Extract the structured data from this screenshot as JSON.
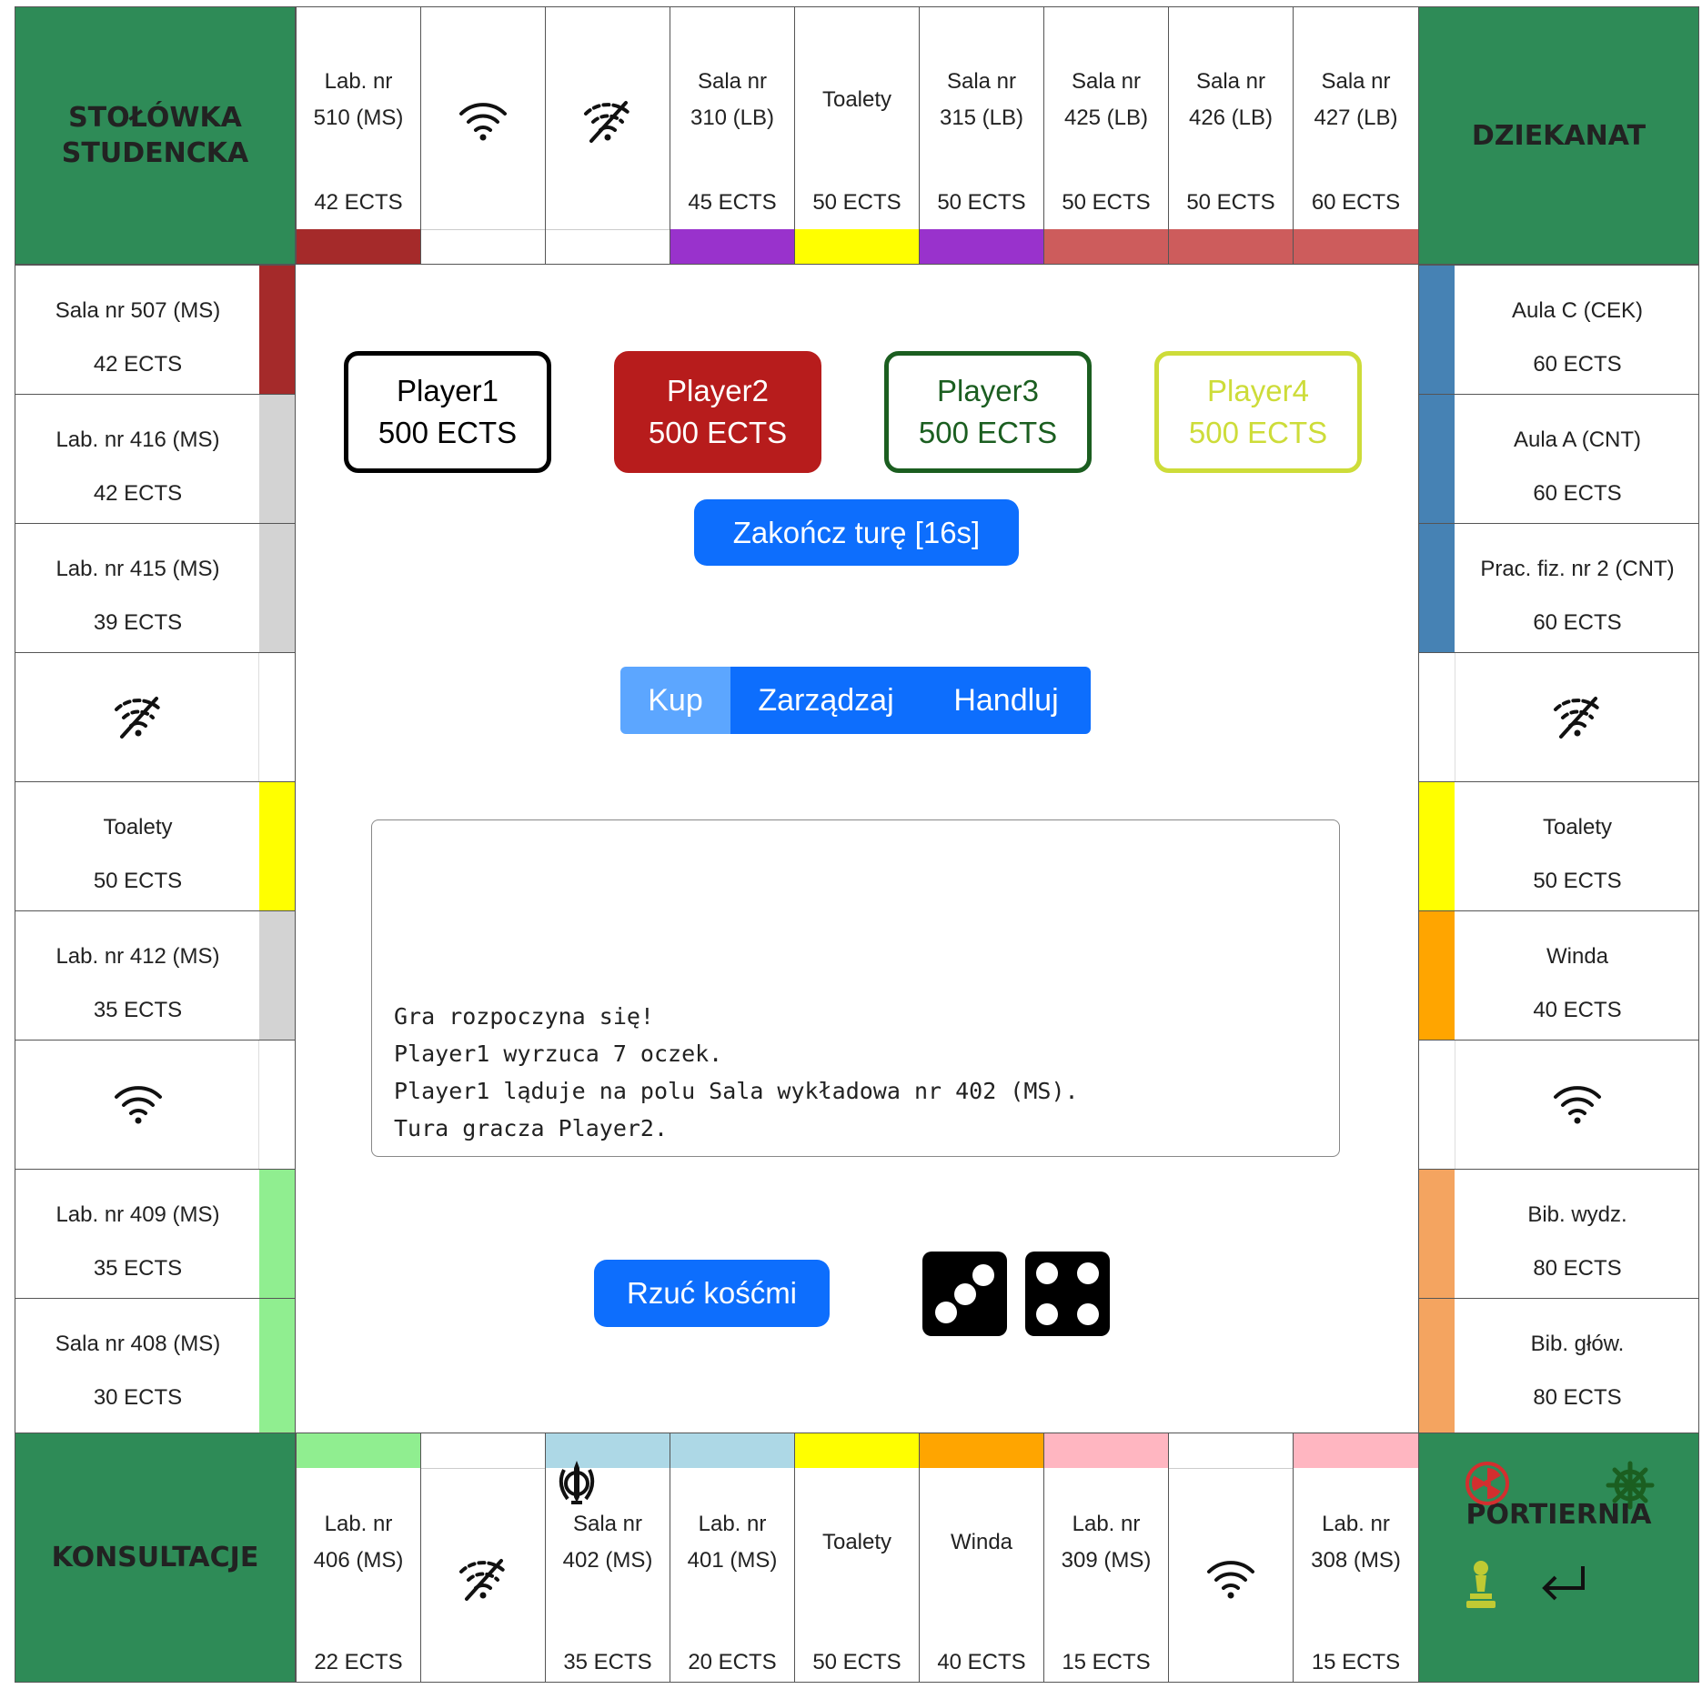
{
  "corners": {
    "top_left": {
      "line1": "STOŁÓWKA",
      "line2": "STUDENCKA"
    },
    "top_right": {
      "label": "DZIEKANAT"
    },
    "bottom_left": {
      "label": "KONSULTACJE"
    },
    "bottom_right": {
      "label": "PORTIERNIA"
    }
  },
  "top_row": [
    {
      "line1": "Lab. nr",
      "line2": "510 (MS)",
      "price": "42 ECTS",
      "color": "#a52a2a"
    },
    {
      "icon": "wifi-icon"
    },
    {
      "icon": "wifi-off-icon"
    },
    {
      "line1": "Sala nr",
      "line2": "310 (LB)",
      "price": "45 ECTS",
      "color": "#9932cc"
    },
    {
      "line1": "Toalety",
      "price": "50 ECTS",
      "color": "#ffff00"
    },
    {
      "line1": "Sala nr",
      "line2": "315 (LB)",
      "price": "50 ECTS",
      "color": "#9932cc"
    },
    {
      "line1": "Sala nr",
      "line2": "425 (LB)",
      "price": "50 ECTS",
      "color": "#cd5c5c"
    },
    {
      "line1": "Sala nr",
      "line2": "426 (LB)",
      "price": "50 ECTS",
      "color": "#cd5c5c"
    },
    {
      "line1": "Sala nr",
      "line2": "427 (LB)",
      "price": "60 ECTS",
      "color": "#cd5c5c"
    }
  ],
  "left_col": [
    {
      "name": "Sala nr 507 (MS)",
      "price": "42 ECTS",
      "color": "#a52a2a"
    },
    {
      "name": "Lab. nr 416 (MS)",
      "price": "42 ECTS",
      "color": "#d3d3d3"
    },
    {
      "name": "Lab. nr 415 (MS)",
      "price": "39 ECTS",
      "color": "#d3d3d3"
    },
    {
      "icon": "wifi-off-icon"
    },
    {
      "name": "Toalety",
      "price": "50 ECTS",
      "color": "#ffff00"
    },
    {
      "name": "Lab. nr 412 (MS)",
      "price": "35 ECTS",
      "color": "#d3d3d3"
    },
    {
      "icon": "wifi-icon"
    },
    {
      "name": "Lab. nr 409 (MS)",
      "price": "35 ECTS",
      "color": "#90ee90"
    },
    {
      "name": "Sala nr 408 (MS)",
      "price": "30 ECTS",
      "color": "#90ee90"
    }
  ],
  "right_col": [
    {
      "name": "Aula C (CEK)",
      "price": "60 ECTS",
      "color": "#4682b4"
    },
    {
      "name": "Aula A (CNT)",
      "price": "60 ECTS",
      "color": "#4682b4"
    },
    {
      "name": "Prac. fiz. nr 2 (CNT)",
      "price": "60 ECTS",
      "color": "#4682b4"
    },
    {
      "icon": "wifi-off-icon"
    },
    {
      "name": "Toalety",
      "price": "50 ECTS",
      "color": "#ffff00"
    },
    {
      "name": "Winda",
      "price": "40 ECTS",
      "color": "#ffa500"
    },
    {
      "icon": "wifi-icon"
    },
    {
      "name": "Bib. wydz.",
      "price": "80 ECTS",
      "color": "#f4a460"
    },
    {
      "name": "Bib. głów.",
      "price": "80 ECTS",
      "color": "#f4a460"
    }
  ],
  "bottom_row": [
    {
      "line1": "Lab. nr",
      "line2": "406 (MS)",
      "price": "22 ECTS",
      "color": "#90ee90"
    },
    {
      "icon": "wifi-off-icon"
    },
    {
      "line1": "Sala nr",
      "line2": "402 (MS)",
      "price": "35 ECTS",
      "color": "#add8e6",
      "token": "khanda-icon"
    },
    {
      "line1": "Lab. nr",
      "line2": "401 (MS)",
      "price": "20 ECTS",
      "color": "#add8e6"
    },
    {
      "line1": "Toalety",
      "price": "50 ECTS",
      "color": "#ffff00"
    },
    {
      "line1": "Winda",
      "price": "40 ECTS",
      "color": "#ffa500"
    },
    {
      "line1": "Lab. nr",
      "line2": "309 (MS)",
      "price": "15 ECTS",
      "color": "#ffb6c1"
    },
    {
      "icon": "wifi-icon"
    },
    {
      "line1": "Lab. nr",
      "line2": "308 (MS)",
      "price": "15 ECTS",
      "color": "#ffb6c1"
    }
  ],
  "players": [
    {
      "name": "Player1",
      "ects": "500 ECTS",
      "style": "outlined",
      "color": "#000000"
    },
    {
      "name": "Player2",
      "ects": "500 ECTS",
      "style": "filled",
      "color": "#b71c1c"
    },
    {
      "name": "Player3",
      "ects": "500 ECTS",
      "style": "outlined",
      "color": "#1b5e20"
    },
    {
      "name": "Player4",
      "ects": "500 ECTS",
      "style": "outlined",
      "color": "#cddc39"
    }
  ],
  "end_turn_button": "Zakończ turę [16s]",
  "tabs": [
    {
      "label": "Kup",
      "active": true
    },
    {
      "label": "Zarządzaj",
      "active": false
    },
    {
      "label": "Handluj",
      "active": false
    }
  ],
  "log": [
    "Gra rozpoczyna się!",
    "Player1 wyrzuca 7 oczek.",
    "Player1 ląduje na polu Sala wykładowa nr 402 (MS).",
    "Tura gracza Player2."
  ],
  "roll_button": "Rzuć kośćmi",
  "dice": [
    3,
    4
  ],
  "portiernia_tokens": [
    "radiation-icon",
    "helm-icon",
    "chess-pawn-icon",
    "return-arrow-icon"
  ],
  "colors": {
    "corner": "#2e8b57",
    "accent": "#0d6efd",
    "tab_active": "#5ca6ff"
  }
}
